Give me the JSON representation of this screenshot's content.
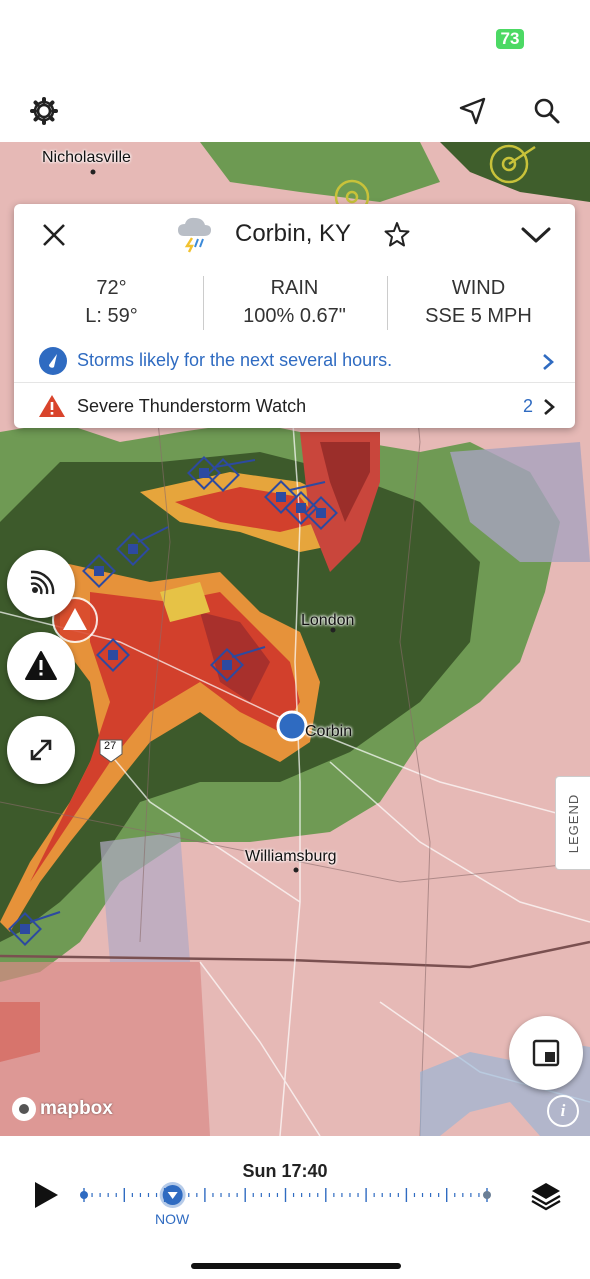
{
  "status": {
    "battery": "73"
  },
  "toolbar": {
    "settings_icon": "gear-icon",
    "locate_icon": "location-arrow-icon",
    "search_icon": "search-icon"
  },
  "map": {
    "labels": {
      "nicholasville": "Nicholasville",
      "london": "London",
      "corbin": "Corbin",
      "williamsburg": "Williamsburg",
      "route": "27"
    },
    "attribution": "mapbox",
    "legend_label": "LEGEND"
  },
  "card": {
    "location": "Corbin, KY",
    "weather_icon": "thunderstorm-icon",
    "temp": "72°",
    "low": "L: 59°",
    "rain_label": "RAIN",
    "rain_value": "100% 0.67\"",
    "wind_label": "WIND",
    "wind_value": "SSE 5 MPH",
    "forecast": "Storms likely for the next several hours.",
    "alert": "Severe Thunderstorm Watch",
    "alert_count": "2"
  },
  "timeline": {
    "time": "Sun 17:40",
    "now_label": "NOW",
    "current_fraction": 0.22
  },
  "colors": {
    "accent": "#2f6bc1",
    "warning": "#d9442c"
  }
}
